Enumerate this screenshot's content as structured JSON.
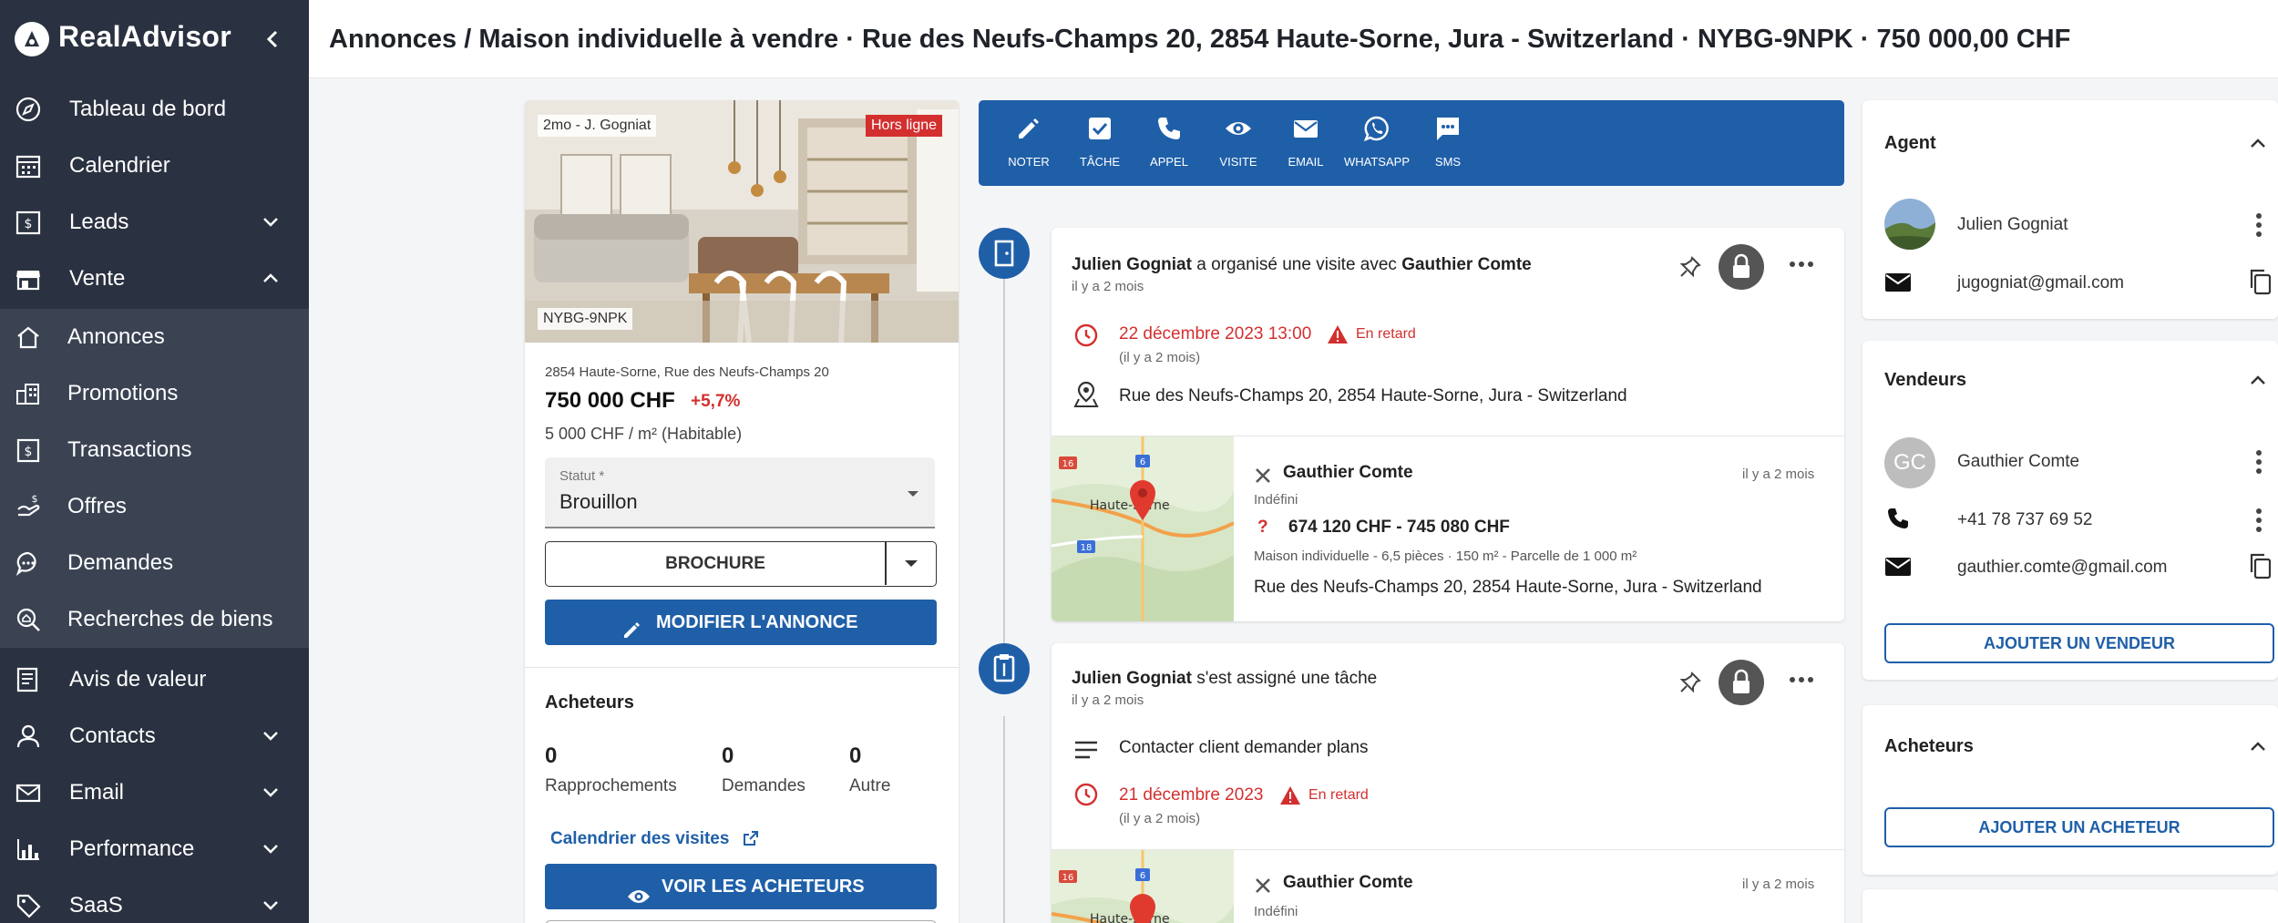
{
  "app": {
    "name": "RealAdvisor"
  },
  "sidebar": {
    "items": [
      {
        "label": "Tableau de bord",
        "icon": "compass-icon"
      },
      {
        "label": "Calendrier",
        "icon": "calendar-icon"
      },
      {
        "label": "Leads",
        "icon": "leads-icon"
      },
      {
        "label": "Vente",
        "icon": "store-icon"
      },
      {
        "label": "Annonces",
        "icon": "home-icon"
      },
      {
        "label": "Promotions",
        "icon": "building-icon"
      },
      {
        "label": "Transactions",
        "icon": "receipt-icon"
      },
      {
        "label": "Offres",
        "icon": "offer-icon"
      },
      {
        "label": "Demandes",
        "icon": "chat-icon"
      },
      {
        "label": "Recherches de biens",
        "icon": "search-home-icon"
      },
      {
        "label": "Avis de valeur",
        "icon": "document-icon"
      },
      {
        "label": "Contacts",
        "icon": "person-icon"
      },
      {
        "label": "Email",
        "icon": "mail-icon"
      },
      {
        "label": "Performance",
        "icon": "bar-chart-icon"
      },
      {
        "label": "SaaS",
        "icon": "tag-icon"
      }
    ]
  },
  "header": {
    "title": "Annonces / Maison individuelle à vendre · Rue des Neufs-Champs 20, 2854 Haute-Sorne, Jura - Switzerland · NYBG-9NPK · 750 000,00 CHF"
  },
  "listing": {
    "photo_badge": "2mo - J. Gogniat",
    "status_badge": "Hors ligne",
    "ref_badge": "NYBG-9NPK",
    "address": "2854 Haute-Sorne, Rue des Neufs-Champs 20",
    "price": "750 000 CHF",
    "price_change": "+5,7%",
    "price_m2": "5 000 CHF / m² (Habitable)",
    "status_label": "Statut *",
    "status_value": "Brouillon",
    "brochure": "BROCHURE",
    "edit": "MODIFIER L'ANNONCE",
    "buyers_title": "Acheteurs",
    "stats": [
      {
        "value": "0",
        "label": "Rapprochements"
      },
      {
        "value": "0",
        "label": "Demandes"
      },
      {
        "value": "0",
        "label": "Autre"
      }
    ],
    "visits_calendar": "Calendrier des visites",
    "view_buyers": "VOIR LES ACHETEURS"
  },
  "actions": [
    "NOTER",
    "TÂCHE",
    "APPEL",
    "VISITE",
    "EMAIL",
    "WHATSAPP",
    "SMS"
  ],
  "feed": {
    "event1": {
      "actor": "Julien Gogniat",
      "verb": " a organisé une visite avec ",
      "target": "Gauthier Comte",
      "time": "il y a 2 mois",
      "date": "22 décembre 2023 13:00",
      "late": "En retard",
      "date_rel": "(il y a 2 mois)",
      "address": "Rue des Neufs-Champs 20, 2854 Haute-Sorne, Jura - Switzerland",
      "contact_name": "Gauthier Comte",
      "contact_time": "il y a 2 mois",
      "contact_status": "Indéfini",
      "price_range": "674 120 CHF - 745 080 CHF",
      "details": "Maison individuelle - 6,5 pièces · 150 m² - Parcelle de 1 000 m²",
      "contact_address": "Rue des Neufs-Champs 20, 2854 Haute-Sorne, Jura - Switzerland",
      "map_labels": [
        "16",
        "6",
        "Haute-Sorne",
        "18"
      ]
    },
    "event2": {
      "actor": "Julien Gogniat",
      "verb": " s'est assigné une tâche",
      "time": "il y a 2 mois",
      "task": "Contacter client demander plans",
      "date": "21 décembre 2023",
      "late": "En retard",
      "date_rel": "(il y a 2 mois)",
      "contact_name": "Gauthier Comte",
      "contact_time": "il y a 2 mois",
      "contact_status": "Indéfini",
      "map_labels": [
        "16",
        "6",
        "Haute-Sorne"
      ]
    }
  },
  "right": {
    "agent_title": "Agent",
    "agent_name": "Julien Gogniat",
    "agent_email": "jugogniat@gmail.com",
    "sellers_title": "Vendeurs",
    "seller_initials": "GC",
    "seller_name": "Gauthier Comte",
    "seller_phone": "+41 78 737 69 52",
    "seller_email": "gauthier.comte@gmail.com",
    "add_seller": "AJOUTER UN VENDEUR",
    "buyers_title": "Acheteurs",
    "add_buyer": "AJOUTER UN ACHETEUR"
  },
  "colors": {
    "brand": "#1f5fa8",
    "sidebar": "#2a3140",
    "danger": "#d32f2f"
  }
}
